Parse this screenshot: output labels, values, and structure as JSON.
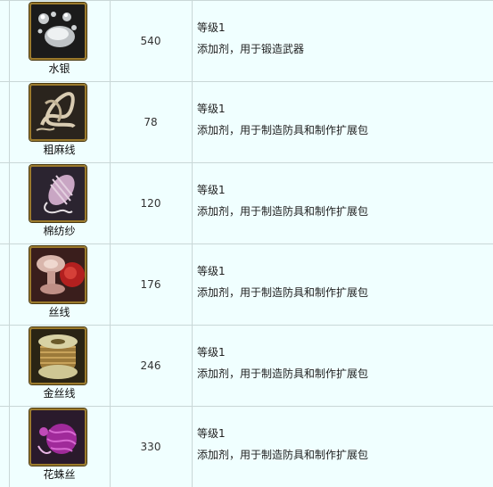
{
  "items": [
    {
      "name": "水银",
      "qty": "540",
      "level": "等级1",
      "desc": "添加剂，用于锻造武器",
      "icon": "mercury-icon"
    },
    {
      "name": "粗麻线",
      "qty": "78",
      "level": "等级1",
      "desc": "添加剂，用于制造防具和制作扩展包",
      "icon": "coarse-hemp-thread-icon"
    },
    {
      "name": "棉纺纱",
      "qty": "120",
      "level": "等级1",
      "desc": "添加剂，用于制造防具和制作扩展包",
      "icon": "cotton-yarn-icon"
    },
    {
      "name": "丝线",
      "qty": "176",
      "level": "等级1",
      "desc": "添加剂，用于制造防具和制作扩展包",
      "icon": "silk-thread-icon"
    },
    {
      "name": "金丝线",
      "qty": "246",
      "level": "等级1",
      "desc": "添加剂，用于制造防具和制作扩展包",
      "icon": "gold-thread-spool-icon"
    },
    {
      "name": "花蛛丝",
      "qty": "330",
      "level": "等级1",
      "desc": "添加剂，用于制造防具和制作扩展包",
      "icon": "spider-silk-icon"
    }
  ]
}
